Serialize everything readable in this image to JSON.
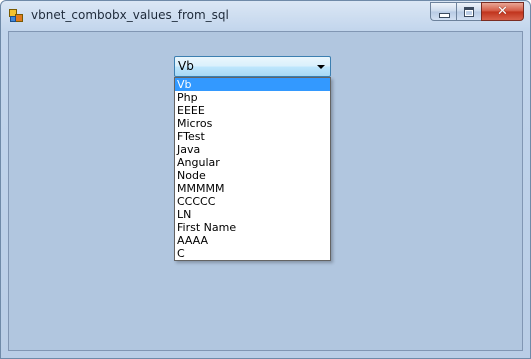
{
  "window": {
    "title": "vbnet_combobx_values_from_sql"
  },
  "combobox": {
    "selected": "Vb",
    "options": [
      "Vb",
      "Php",
      "EEEE",
      "Micros",
      "FTest",
      "Java",
      "Angular",
      "Node",
      "MMMMM",
      "CCCCC",
      "LN",
      "First Name",
      "AAAA",
      "C"
    ],
    "highlighted_index": 0
  },
  "colors": {
    "client_background": "#b1c6df",
    "selection": "#3399ff",
    "close_button": "#c0321b"
  },
  "icons": {
    "app": "winforms-app-icon",
    "minimize": "minimize-icon",
    "maximize": "maximize-icon",
    "close": "close-icon",
    "dropdown": "chevron-down-icon"
  }
}
